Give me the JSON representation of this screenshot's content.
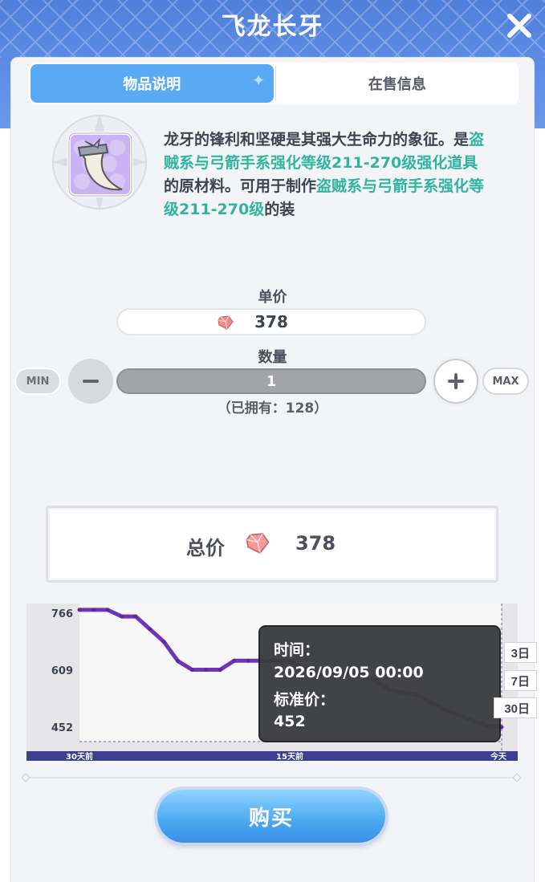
{
  "window": {
    "title": "飞龙长牙"
  },
  "tabs": [
    {
      "label": "物品说明"
    },
    {
      "label": "在售信息"
    }
  ],
  "item": {
    "description_parts": [
      {
        "text": "龙牙的锋利和坚硬是其强大生命力的象征。是",
        "highlight": false
      },
      {
        "text": "盗贼系与弓箭手系强化等级211-270级强化道具",
        "highlight": true
      },
      {
        "text": "的原材料。可用于制作",
        "highlight": false
      },
      {
        "text": "盗贼系与弓箭手系强化等级211-270级",
        "highlight": true
      },
      {
        "text": "的装",
        "highlight": false
      }
    ]
  },
  "price": {
    "unit_label": "单价",
    "unit_value": "378"
  },
  "quantity": {
    "label": "数量",
    "value": "1",
    "min_label": "MIN",
    "max_label": "MAX",
    "owned_text": "（已拥有：128）"
  },
  "total": {
    "label": "总价",
    "value": "378"
  },
  "colors": {
    "accent": "#5aaaf3",
    "highlight": "#2fb4a0",
    "line": "#6f35b8"
  },
  "chart_data": {
    "type": "line",
    "x_tick_labels": [
      "30天前",
      "15天前",
      "今天"
    ],
    "y_tick_labels": [
      "766",
      "609",
      "452"
    ],
    "ylim": [
      452,
      766
    ],
    "x": [
      0,
      1,
      2,
      3,
      4,
      5,
      6,
      7,
      8,
      9,
      10,
      11,
      12,
      13,
      14,
      15,
      16,
      17,
      18,
      19,
      20,
      21,
      22,
      23,
      24,
      25,
      26,
      27,
      28,
      29,
      30
    ],
    "series": [
      {
        "values": [
          775,
          775,
          775,
          757,
          757,
          722,
          687,
          634,
          610,
          610,
          610,
          635,
          635,
          635,
          635,
          635,
          610,
          596,
          596,
          596,
          596,
          582,
          555,
          548,
          541,
          520,
          500,
          484,
          469,
          455,
          452
        ]
      }
    ],
    "tooltip": {
      "time_label": "时间：",
      "time_value": "2026/09/05 00:00",
      "price_label": "标准价：",
      "price_value": "452"
    },
    "range_options": [
      "3日",
      "7日",
      "30日"
    ],
    "grid": false
  },
  "buy": {
    "label": "购买"
  }
}
